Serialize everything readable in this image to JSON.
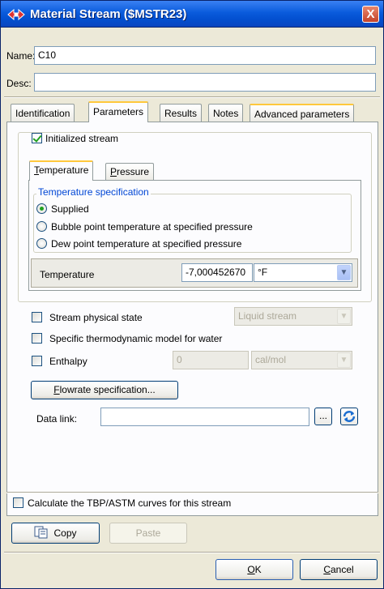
{
  "window": {
    "title": "Material Stream ($MSTR23)",
    "close_glyph": "X"
  },
  "fields": {
    "name_label": "Name:",
    "name_value": "C10",
    "desc_label": "Desc:",
    "desc_value": ""
  },
  "tabs": [
    {
      "label": "Identification"
    },
    {
      "label": "Parameters"
    },
    {
      "label": "Results"
    },
    {
      "label": "Notes"
    },
    {
      "label": "Advanced parameters"
    }
  ],
  "parameters": {
    "initialized_stream": {
      "label": "Initialized stream",
      "checked": true
    },
    "subtabs": [
      {
        "label_u": "T",
        "label_rest": "emperature"
      },
      {
        "label_u": "P",
        "label_rest": "ressure"
      }
    ],
    "temp_spec": {
      "legend": "Temperature specification",
      "options": [
        {
          "label": "Supplied",
          "selected": true
        },
        {
          "label": "Bubble point temperature at specified pressure",
          "selected": false
        },
        {
          "label": "Dew point temperature at specified pressure",
          "selected": false
        }
      ],
      "temperature_label": "Temperature",
      "temperature_value": "-7,000452670",
      "temperature_unit": "°F"
    },
    "stream_physical_state": {
      "label": "Stream physical state",
      "value": "Liquid stream"
    },
    "specific_model_water": {
      "label": "Specific thermodynamic model for water"
    },
    "enthalpy": {
      "label": "Enthalpy",
      "value": "0",
      "unit": "cal/mol"
    },
    "flowrate_button": {
      "label_u": "F",
      "label_rest": "lowrate specification..."
    },
    "data_link": {
      "label": "Data link:",
      "value": "",
      "browse": "..."
    },
    "tbp_curves": {
      "label": "Calculate the TBP/ASTM curves for this stream"
    },
    "copy_button": "Copy",
    "paste_button": "Paste"
  },
  "footer": {
    "ok_u": "O",
    "ok_rest": "K",
    "cancel_u": "C",
    "cancel_rest": "ancel"
  },
  "colors": {
    "titlebar": "#0a5bdc",
    "accent": "#ffc83c",
    "legend": "#0046d5",
    "check": "#21a121"
  }
}
